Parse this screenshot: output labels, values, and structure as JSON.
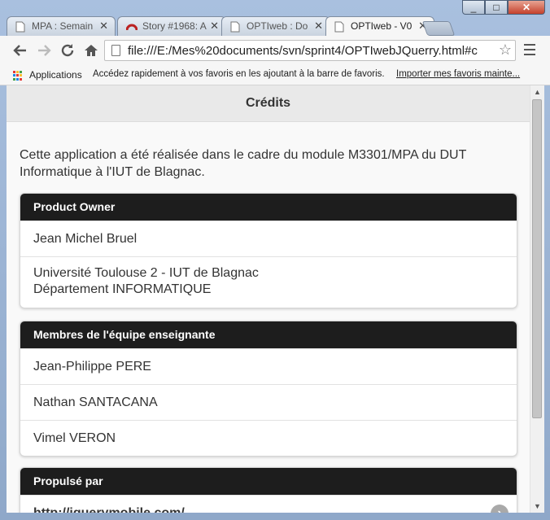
{
  "tabs": [
    {
      "title": "MPA : Semain",
      "icon": "page-icon"
    },
    {
      "title": "Story #1968: A",
      "icon": "redmine-icon"
    },
    {
      "title": "OPTIweb : Do",
      "icon": "page-icon"
    },
    {
      "title": "OPTIweb - V0",
      "icon": "page-icon",
      "active": true
    }
  ],
  "window_controls": {
    "minimize": "_",
    "maximize": "□",
    "close": "✕"
  },
  "address_bar": {
    "url": "file:///E:/Mes%20documents/svn/sprint4/OPTIwebJQuerry.html#c"
  },
  "bookmarks_bar": {
    "apps_label": "Applications",
    "hint": "Accédez rapidement à vos favoris en les ajoutant à la barre de favoris.",
    "import_link": "Importer mes favoris mainte..."
  },
  "page": {
    "header_title": "Crédits",
    "intro": "Cette application a été réalisée dans le cadre du module M3301/MPA du DUT Informatique à l'IUT de Blagnac.",
    "product_owner": {
      "title": "Product Owner",
      "name": "Jean Michel Bruel",
      "affiliation_line1": "Université Toulouse 2 - IUT de Blagnac",
      "affiliation_line2": "Département INFORMATIQUE"
    },
    "team": {
      "title": "Membres de l'équipe enseignante",
      "members": [
        "Jean-Philippe PERE",
        "Nathan SANTACANA",
        "Vimel VERON"
      ]
    },
    "powered": {
      "title": "Propulsé par",
      "link": "http://jquerymobile.com/"
    }
  },
  "colors": {
    "card_header": "#1d1d1d",
    "page_bg": "#f9f9f9",
    "header_bg": "#e9e9e9"
  }
}
